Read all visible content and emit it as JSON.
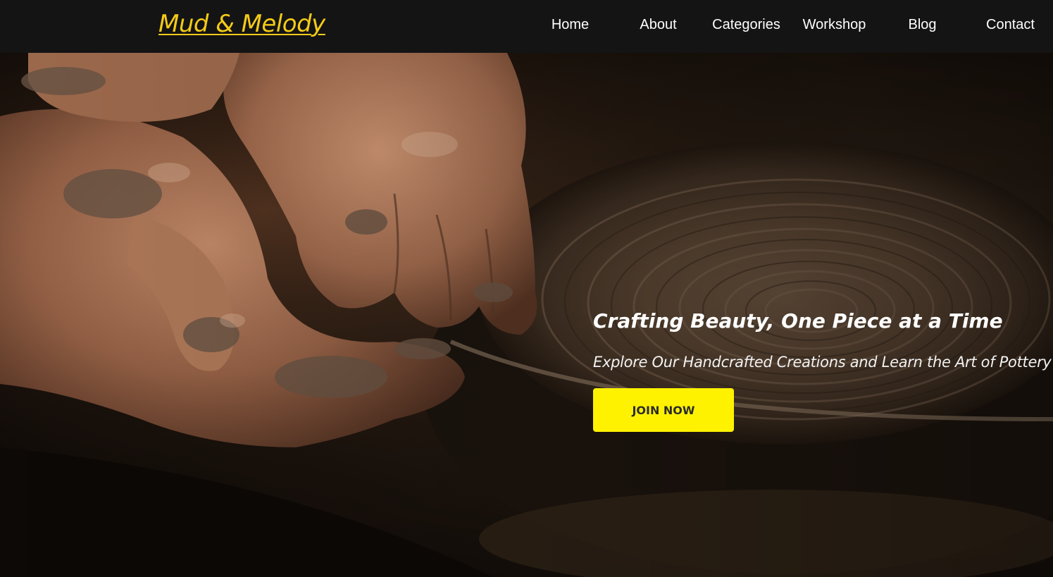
{
  "brand": {
    "name": "Mud & Melody",
    "color": "#f5cb17"
  },
  "nav": {
    "items": [
      {
        "label": "Home"
      },
      {
        "label": "About"
      },
      {
        "label": "Categories"
      },
      {
        "label": "Workshop"
      },
      {
        "label": "Blog"
      },
      {
        "label": "Contact"
      }
    ]
  },
  "hero": {
    "title": "Crafting Beauty, One Piece at a Time",
    "subtitle": "Explore Our Handcrafted Creations and Learn the Art of Pottery",
    "cta_label": "JOIN NOW",
    "cta_color": "#fff200",
    "background_image": "hands-shaping-clay-on-pottery-wheel"
  }
}
